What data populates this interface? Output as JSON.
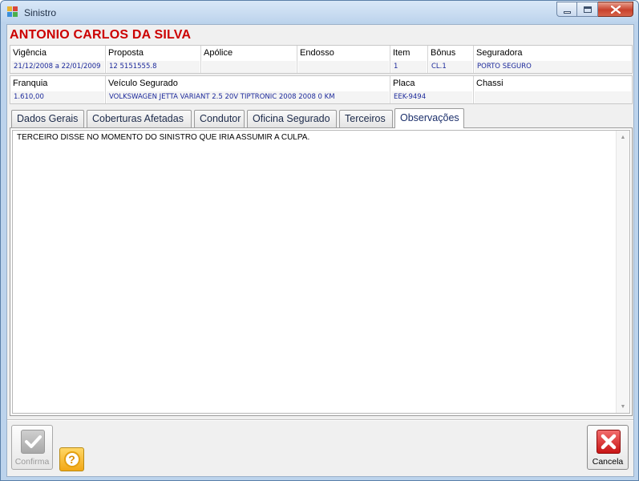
{
  "window": {
    "title": "Sinistro",
    "buttons": {
      "minimize": "minimize",
      "maximize": "maximize",
      "close": "close"
    }
  },
  "customer": {
    "name": "ANTONIO CARLOS DA SILVA"
  },
  "info_row1": [
    {
      "label": "Vigência",
      "value": "21/12/2008 a 22/01/2009"
    },
    {
      "label": "Proposta",
      "value": "12 5151555.8"
    },
    {
      "label": "Apólice",
      "value": ""
    },
    {
      "label": "Endosso",
      "value": ""
    },
    {
      "label": "Item",
      "value": "1"
    },
    {
      "label": "Bônus",
      "value": "CL.1"
    },
    {
      "label": "Seguradora",
      "value": "PORTO SEGURO"
    }
  ],
  "info_row2": [
    {
      "label": "Franquia",
      "value": "1.610,00"
    },
    {
      "label": "Veículo Segurado",
      "value": "VOLKSWAGEN JETTA VARIANT 2.5 20V TIPTRONIC 2008 2008 0 KM"
    },
    {
      "label": "Placa",
      "value": "EEK-9494"
    },
    {
      "label": "Chassi",
      "value": ""
    }
  ],
  "tabs": [
    {
      "label": "Dados Gerais",
      "active": false
    },
    {
      "label": "Coberturas Afetadas",
      "active": false
    },
    {
      "label": "Condutor",
      "active": false
    },
    {
      "label": "Oficina Segurado",
      "active": false
    },
    {
      "label": "Terceiros",
      "active": false
    },
    {
      "label": "Observações",
      "active": true
    }
  ],
  "observations": {
    "text": "TERCEIRO DISSE NO MOMENTO DO SINISTRO QUE IRIA ASSUMIR A CULPA."
  },
  "footer": {
    "confirm_label": "Confirma",
    "confirm_enabled": false,
    "cancel_label": "Cancela",
    "help_symbol": "?"
  },
  "colors": {
    "customer_name": "#cc0000",
    "field_value": "#1d2a9b",
    "cancel_icon": "#c81414",
    "help_icon": "#f2a716"
  }
}
